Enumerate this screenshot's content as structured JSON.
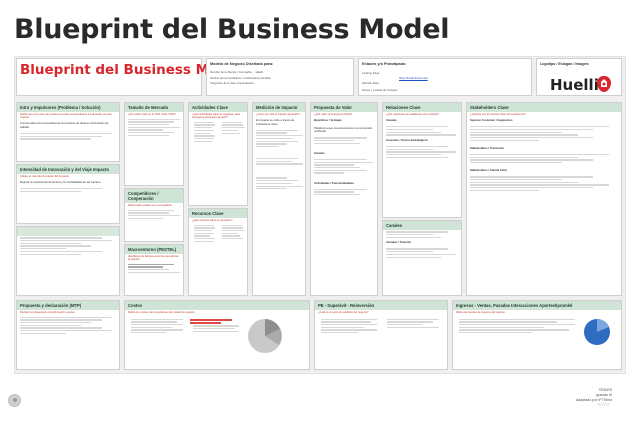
{
  "page": {
    "title": "Blueprint del Business Model",
    "inner_title": "Blueprint del Business Model",
    "brand": "Huelli",
    "author": "©EMOS",
    "credit_line_1": "gracias IrI",
    "credit_line_2": "Adaptado por IFTSima",
    "watermark": "miro"
  },
  "top_cards": {
    "modelo": {
      "label": "Modelo de Negocio Diseñado para:",
      "field_1": "Nombre de la Startup / Compañía:",
      "field_1_value": "Huelli",
      "field_2": "Nombre de los Fundadores / Colaboradores (E-Mail):",
      "field_3": "Integrantes de la clase emprendedora:"
    },
    "enlaces": {
      "label": "Enlaces y/o Prototipado:",
      "landing_label": "Landing Page:",
      "landing_value": "https://huelli.framer.site",
      "website_label": "Website Beta:",
      "demo_label": "Demos y pruebas de concepto:"
    },
    "logo": {
      "label": "Logotipo / Eslogan / Imagen:"
    }
  },
  "cards": {
    "intro": {
      "title": "Intro y Impulsores (Problema / Solución)",
      "sub": "Defina qué es lo que más motiva a la clase emprendedora a emprender en este negocio",
      "body": "Comprendemos la necesidad de los lectores de obtener información de calidad."
    },
    "intensidad": {
      "title": "Intensidad de Innovación y del Viaje Impacto",
      "sub": "Indique el nivel de innovación del proyecto",
      "body": "Mejorar la experiencia de lectura y la confiabilidad de las fuentes."
    },
    "mercado": {
      "title": "Tamaño de Mercado",
      "sub": "¿De cuánto valor es el TAM, SAM, SOM?"
    },
    "competidores": {
      "title": "Competidores / Cooperación",
      "sub": "Defina quién puede ser su competidor"
    },
    "macro": {
      "title": "Macroentorno (PESTEL)",
      "sub": "Identifique los factores externos que afectan al negocio"
    },
    "actividades": {
      "title": "Actividades Clave",
      "sub": "¿Qué actividades clave se requieren para entregar la propuesta de valor?"
    },
    "recursos": {
      "title": "Recursos Clave",
      "sub": "¿Qué recursos clave se requieren?"
    },
    "medicion": {
      "title": "Medición de Impacto",
      "sub": "¿Cómo se mide el impacto generado?",
      "body": "El impacto se mide a través de indicadores clave."
    },
    "propuesta": {
      "title": "Propuesta de Valor",
      "sub": "¿Qué valor se entrega al cliente?",
      "section_1": "Beneficios / Ventajas",
      "section_2": "Canales",
      "section_3": "Actividades / Funcionalidades",
      "body": "Plataforma que conecta lectores con contenido verificado."
    },
    "relaciones": {
      "title": "Relaciones Clave",
      "sub": "¿Qué relaciones se establecen con el cliente?",
      "section_1": "Canales",
      "section_2": "Acuerdos / Socios Estratégicos",
      "section_3": "Canales",
      "section_4": "Ventajas / Tracción"
    },
    "stakeholders": {
      "title": "Stakeholders Clave",
      "sub": "¿Quiénes son los actores clave del ecosistema?",
      "section_1": "Sponsor Costumer / Segmentos",
      "section_2": "Stakeholders / Transición",
      "section_3": "Stakeholders / Cliente Final"
    },
    "propuesta_dec": {
      "title": "Propuesta y declaración (MTP)",
      "sub": "Declare la propuesta de transformación masiva"
    },
    "costos": {
      "title": "Costos",
      "sub": "Defina los costos más importantes del modelo de negocio"
    },
    "pe": {
      "title": "PE - Superávit - Reinversión",
      "sub": "¿Cuál es el punto de equilibrio del negocio?"
    },
    "ingresos": {
      "title": "Ingresos - Ventas, Pasadas Interacciones Aportes/Ipromlel",
      "sub": "Defina las fuentes de ingresos del negocio"
    }
  }
}
